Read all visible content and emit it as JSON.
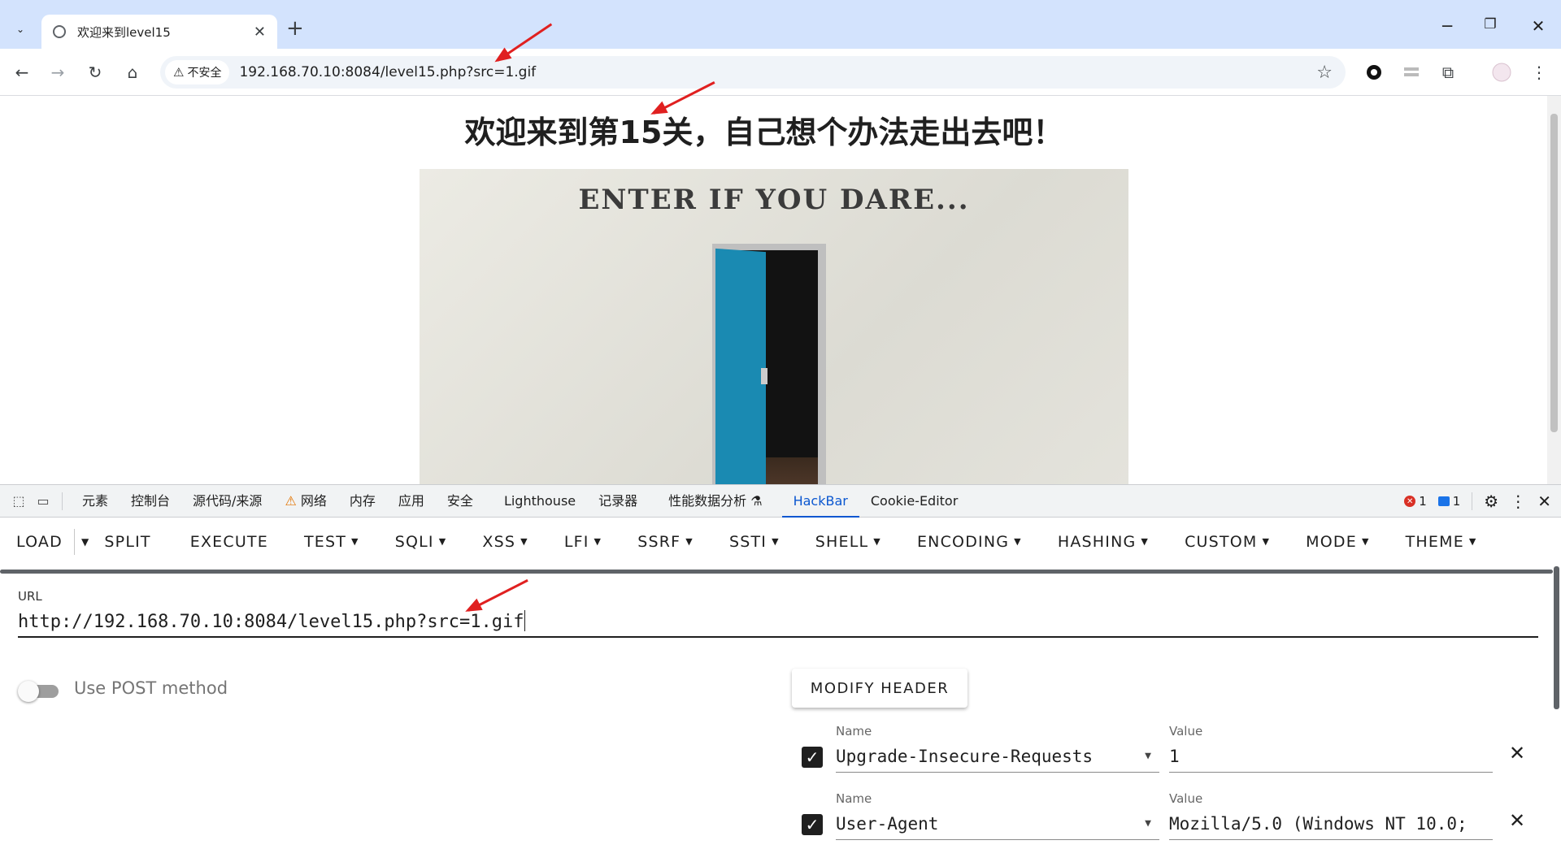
{
  "browser": {
    "tab_title": "欢迎来到level15",
    "security_label": "不安全",
    "url": "192.168.70.10:8084/level15.php?src=1.gif"
  },
  "page": {
    "heading": "欢迎来到第15关，自己想个办法走出去吧！",
    "image_text": "ENTER IF YOU DARE..."
  },
  "devtools": {
    "tabs": [
      "元素",
      "控制台",
      "源代码/来源",
      "网络",
      "内存",
      "应用",
      "安全",
      "Lighthouse",
      "记录器",
      "性能数据分析",
      "HackBar",
      "Cookie-Editor"
    ],
    "active_tab": "HackBar",
    "error_count": "1",
    "message_count": "1"
  },
  "hackbar": {
    "menu": [
      "LOAD",
      "SPLIT",
      "EXECUTE",
      "TEST",
      "SQLI",
      "XSS",
      "LFI",
      "SSRF",
      "SSTI",
      "SHELL",
      "ENCODING",
      "HASHING",
      "CUSTOM",
      "MODE",
      "THEME"
    ],
    "url_label": "URL",
    "url_value": "http://192.168.70.10:8084/level15.php?src=1.gif",
    "post_label": "Use POST method",
    "post_enabled": false,
    "modify_header_label": "MODIFY HEADER",
    "headers": [
      {
        "name_label": "Name",
        "value_label": "Value",
        "name": "Upgrade-Insecure-Requests",
        "value": "1",
        "checked": true
      },
      {
        "name_label": "Name",
        "value_label": "Value",
        "name": "User-Agent",
        "value": "Mozilla/5.0 (Windows NT 10.0;",
        "checked": true
      }
    ]
  },
  "colors": {
    "accent": "#0b57d0",
    "annotation_arrow": "#e02020",
    "door": "#1a8ab2"
  }
}
